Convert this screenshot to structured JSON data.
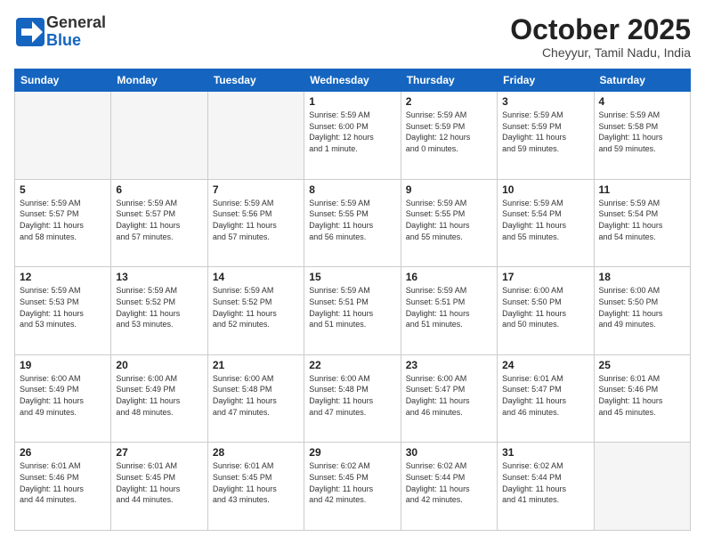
{
  "header": {
    "logo_line1": "General",
    "logo_line2": "Blue",
    "month": "October 2025",
    "location": "Cheyyur, Tamil Nadu, India"
  },
  "weekdays": [
    "Sunday",
    "Monday",
    "Tuesday",
    "Wednesday",
    "Thursday",
    "Friday",
    "Saturday"
  ],
  "weeks": [
    [
      {
        "day": "",
        "info": ""
      },
      {
        "day": "",
        "info": ""
      },
      {
        "day": "",
        "info": ""
      },
      {
        "day": "1",
        "info": "Sunrise: 5:59 AM\nSunset: 6:00 PM\nDaylight: 12 hours\nand 1 minute."
      },
      {
        "day": "2",
        "info": "Sunrise: 5:59 AM\nSunset: 5:59 PM\nDaylight: 12 hours\nand 0 minutes."
      },
      {
        "day": "3",
        "info": "Sunrise: 5:59 AM\nSunset: 5:59 PM\nDaylight: 11 hours\nand 59 minutes."
      },
      {
        "day": "4",
        "info": "Sunrise: 5:59 AM\nSunset: 5:58 PM\nDaylight: 11 hours\nand 59 minutes."
      }
    ],
    [
      {
        "day": "5",
        "info": "Sunrise: 5:59 AM\nSunset: 5:57 PM\nDaylight: 11 hours\nand 58 minutes."
      },
      {
        "day": "6",
        "info": "Sunrise: 5:59 AM\nSunset: 5:57 PM\nDaylight: 11 hours\nand 57 minutes."
      },
      {
        "day": "7",
        "info": "Sunrise: 5:59 AM\nSunset: 5:56 PM\nDaylight: 11 hours\nand 57 minutes."
      },
      {
        "day": "8",
        "info": "Sunrise: 5:59 AM\nSunset: 5:55 PM\nDaylight: 11 hours\nand 56 minutes."
      },
      {
        "day": "9",
        "info": "Sunrise: 5:59 AM\nSunset: 5:55 PM\nDaylight: 11 hours\nand 55 minutes."
      },
      {
        "day": "10",
        "info": "Sunrise: 5:59 AM\nSunset: 5:54 PM\nDaylight: 11 hours\nand 55 minutes."
      },
      {
        "day": "11",
        "info": "Sunrise: 5:59 AM\nSunset: 5:54 PM\nDaylight: 11 hours\nand 54 minutes."
      }
    ],
    [
      {
        "day": "12",
        "info": "Sunrise: 5:59 AM\nSunset: 5:53 PM\nDaylight: 11 hours\nand 53 minutes."
      },
      {
        "day": "13",
        "info": "Sunrise: 5:59 AM\nSunset: 5:52 PM\nDaylight: 11 hours\nand 53 minutes."
      },
      {
        "day": "14",
        "info": "Sunrise: 5:59 AM\nSunset: 5:52 PM\nDaylight: 11 hours\nand 52 minutes."
      },
      {
        "day": "15",
        "info": "Sunrise: 5:59 AM\nSunset: 5:51 PM\nDaylight: 11 hours\nand 51 minutes."
      },
      {
        "day": "16",
        "info": "Sunrise: 5:59 AM\nSunset: 5:51 PM\nDaylight: 11 hours\nand 51 minutes."
      },
      {
        "day": "17",
        "info": "Sunrise: 6:00 AM\nSunset: 5:50 PM\nDaylight: 11 hours\nand 50 minutes."
      },
      {
        "day": "18",
        "info": "Sunrise: 6:00 AM\nSunset: 5:50 PM\nDaylight: 11 hours\nand 49 minutes."
      }
    ],
    [
      {
        "day": "19",
        "info": "Sunrise: 6:00 AM\nSunset: 5:49 PM\nDaylight: 11 hours\nand 49 minutes."
      },
      {
        "day": "20",
        "info": "Sunrise: 6:00 AM\nSunset: 5:49 PM\nDaylight: 11 hours\nand 48 minutes."
      },
      {
        "day": "21",
        "info": "Sunrise: 6:00 AM\nSunset: 5:48 PM\nDaylight: 11 hours\nand 47 minutes."
      },
      {
        "day": "22",
        "info": "Sunrise: 6:00 AM\nSunset: 5:48 PM\nDaylight: 11 hours\nand 47 minutes."
      },
      {
        "day": "23",
        "info": "Sunrise: 6:00 AM\nSunset: 5:47 PM\nDaylight: 11 hours\nand 46 minutes."
      },
      {
        "day": "24",
        "info": "Sunrise: 6:01 AM\nSunset: 5:47 PM\nDaylight: 11 hours\nand 46 minutes."
      },
      {
        "day": "25",
        "info": "Sunrise: 6:01 AM\nSunset: 5:46 PM\nDaylight: 11 hours\nand 45 minutes."
      }
    ],
    [
      {
        "day": "26",
        "info": "Sunrise: 6:01 AM\nSunset: 5:46 PM\nDaylight: 11 hours\nand 44 minutes."
      },
      {
        "day": "27",
        "info": "Sunrise: 6:01 AM\nSunset: 5:45 PM\nDaylight: 11 hours\nand 44 minutes."
      },
      {
        "day": "28",
        "info": "Sunrise: 6:01 AM\nSunset: 5:45 PM\nDaylight: 11 hours\nand 43 minutes."
      },
      {
        "day": "29",
        "info": "Sunrise: 6:02 AM\nSunset: 5:45 PM\nDaylight: 11 hours\nand 42 minutes."
      },
      {
        "day": "30",
        "info": "Sunrise: 6:02 AM\nSunset: 5:44 PM\nDaylight: 11 hours\nand 42 minutes."
      },
      {
        "day": "31",
        "info": "Sunrise: 6:02 AM\nSunset: 5:44 PM\nDaylight: 11 hours\nand 41 minutes."
      },
      {
        "day": "",
        "info": ""
      }
    ]
  ]
}
